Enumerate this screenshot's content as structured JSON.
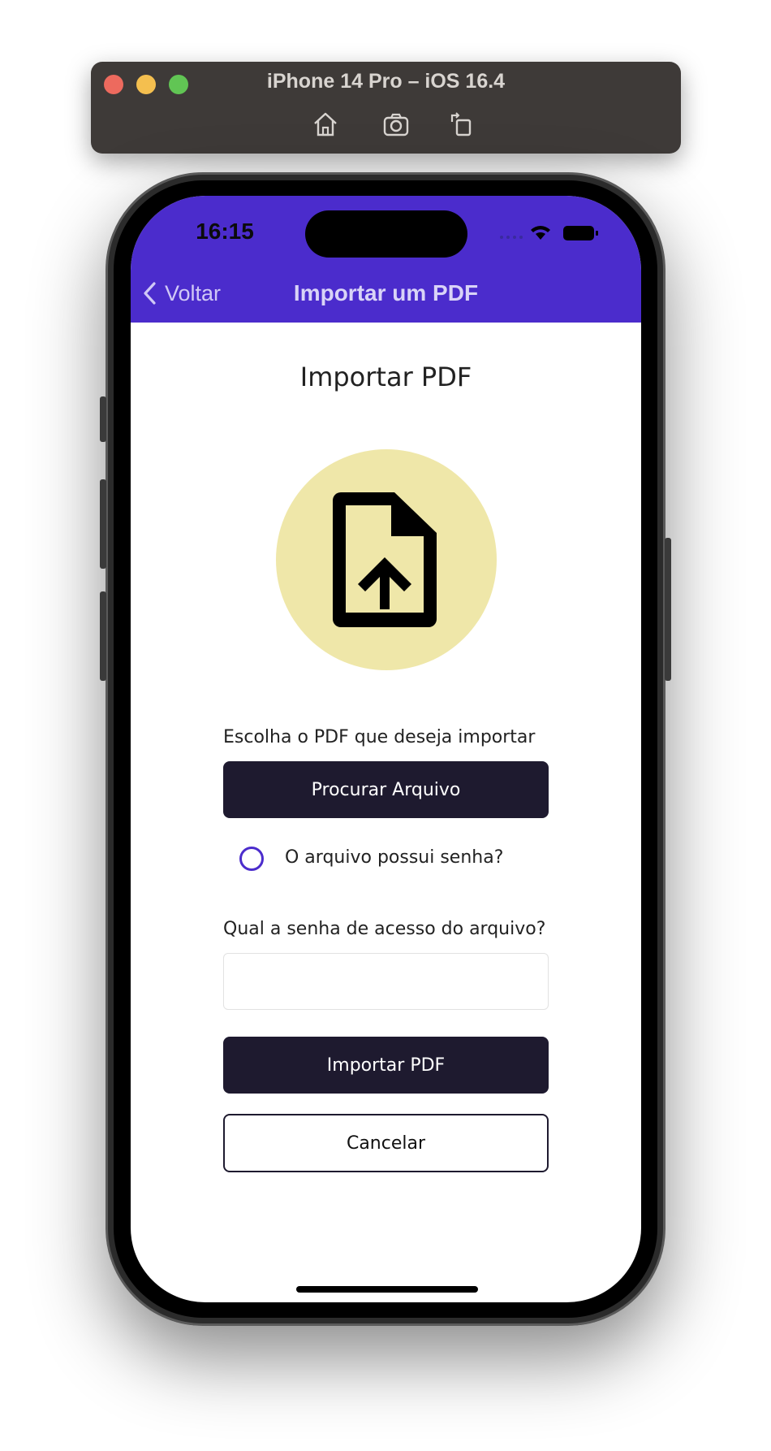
{
  "simulator": {
    "title": "iPhone 14 Pro – iOS 16.4",
    "tools": [
      "home-icon",
      "screenshot-icon",
      "rotate-icon"
    ]
  },
  "status_bar": {
    "time": "16:15"
  },
  "nav": {
    "back_label": "Voltar",
    "title": "Importar um PDF"
  },
  "page": {
    "heading": "Importar PDF",
    "icon": "upload-file-icon",
    "choose_label": "Escolha o PDF que deseja importar",
    "browse_button": "Procurar Arquivo",
    "has_password_label": "O arquivo possui senha?",
    "password_label": "Qual a senha de acesso do arquivo?",
    "password_value": "",
    "import_button": "Importar PDF",
    "cancel_button": "Cancelar"
  },
  "colors": {
    "header": "#4b2ccc",
    "icon_circle": "#efe7a9",
    "button_dark": "#1e1a2f",
    "radio": "#4b2ccc"
  }
}
